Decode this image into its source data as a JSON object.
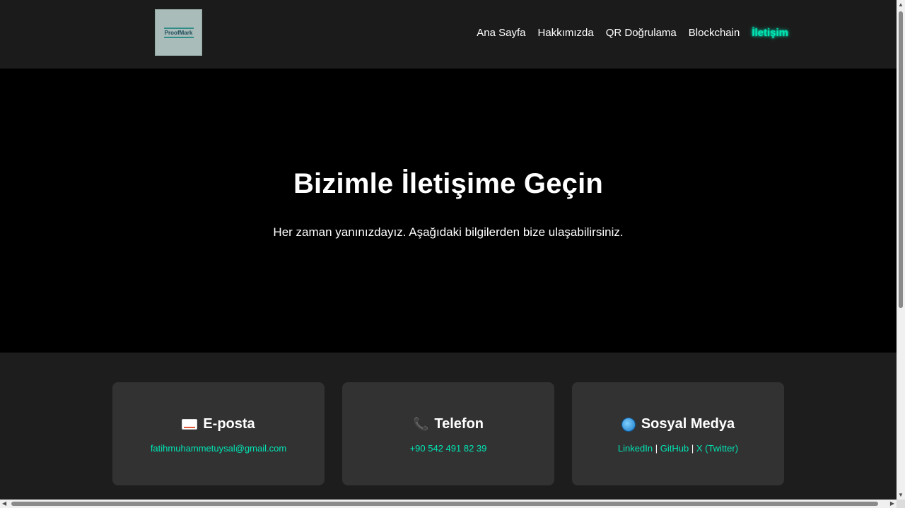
{
  "header": {
    "logo_text": "ProofMark",
    "nav": [
      {
        "label": "Ana Sayfa",
        "active": false
      },
      {
        "label": "Hakkımızda",
        "active": false
      },
      {
        "label": "QR Doğrulama",
        "active": false
      },
      {
        "label": "Blockchain",
        "active": false
      },
      {
        "label": "İletişim",
        "active": true
      }
    ]
  },
  "hero": {
    "title": "Bizimle İletişime Geçin",
    "subtitle": "Her zaman yanınızdayız. Aşağıdaki bilgilerden bize ulaşabilirsiniz."
  },
  "cards": {
    "email": {
      "icon": "envelope-icon",
      "title": "E-posta",
      "value": "fatihmuhammetuysal@gmail.com"
    },
    "phone": {
      "icon": "telephone-icon",
      "title": "Telefon",
      "value": "+90 542 491 82 39"
    },
    "social": {
      "icon": "globe-icon",
      "title": "Sosyal Medya",
      "links": [
        "LinkedIn",
        "GitHub",
        "X (Twitter)"
      ],
      "separator": "|"
    }
  },
  "colors": {
    "accent": "#00e5b4",
    "hero_bg": "#000000",
    "header_bg": "#1b1b1b",
    "card_bg": "#323232"
  }
}
